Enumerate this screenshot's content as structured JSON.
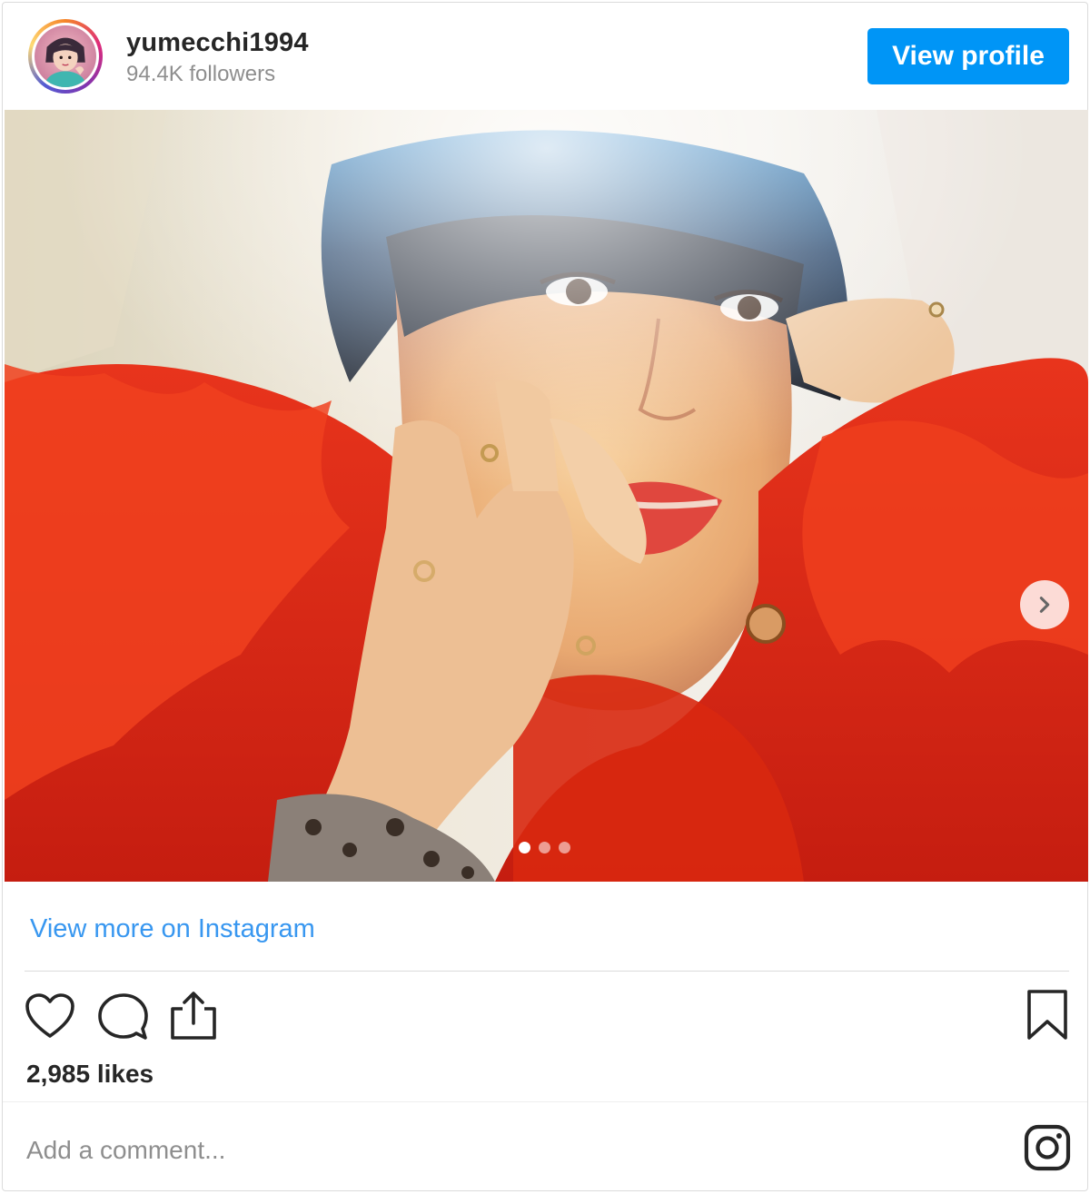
{
  "profile": {
    "username": "yumecchi1994",
    "followers": "94.4K followers",
    "view_profile_label": "View profile",
    "avatar_icon": "avatar-photo"
  },
  "post": {
    "carousel": {
      "slide_count": 3,
      "active_index": 0,
      "next_icon": "chevron-right-icon"
    },
    "view_more_label": "View more on Instagram",
    "likes_text": "2,985 likes",
    "comment_placeholder": "Add a comment..."
  },
  "actions": {
    "like_icon": "heart-icon",
    "comment_icon": "speech-bubble-icon",
    "share_icon": "share-icon",
    "save_icon": "bookmark-icon",
    "brand_icon": "instagram-icon"
  },
  "colors": {
    "accent": "#0095f6",
    "link": "#3897f0",
    "text": "#262626",
    "muted": "#8e8e8e",
    "border": "#dbdbdb"
  }
}
